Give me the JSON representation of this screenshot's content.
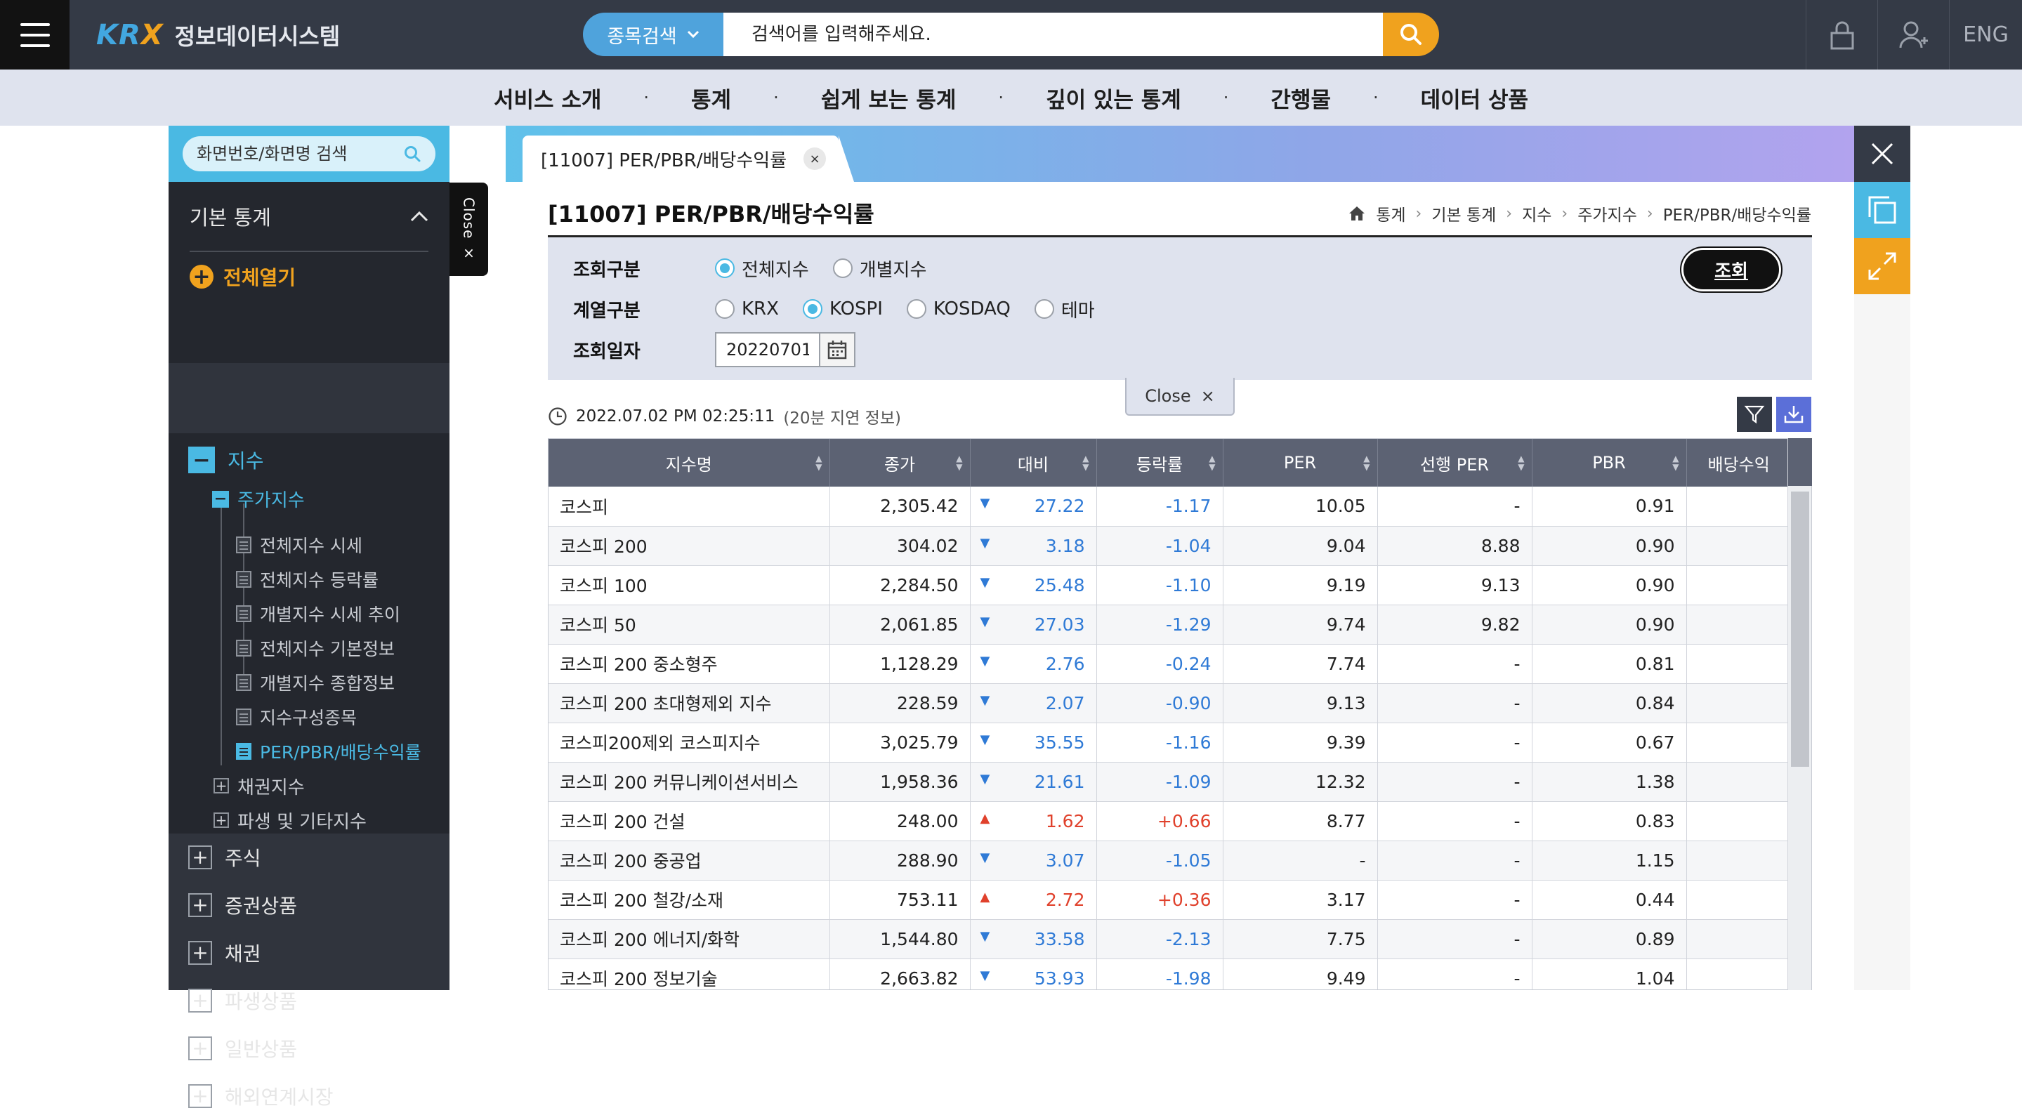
{
  "header": {
    "logo_brand": "KRX",
    "logo_title": "정보데이터시스템",
    "search_type": "종목검색",
    "search_placeholder": "검색어를 입력해주세요.",
    "lang": "ENG"
  },
  "gnb": [
    "서비스 소개",
    "통계",
    "쉽게 보는 통계",
    "깊이 있는 통계",
    "간행물",
    "데이터 상품"
  ],
  "sidebar": {
    "search_placeholder": "화면번호/화면명 검색",
    "section_title": "기본 통계",
    "expand_all": "전체열기",
    "root": "지수",
    "sub": "주가지수",
    "leaves": [
      "전체지수 시세",
      "전체지수 등락률",
      "개별지수 시세 추이",
      "전체지수 기본정보",
      "개별지수 종합정보",
      "지수구성종목",
      "PER/PBR/배당수익률"
    ],
    "siblings": [
      "채권지수",
      "파생 및 기타지수"
    ],
    "categories": [
      "주식",
      "증권상품",
      "채권",
      "파생상품",
      "일반상품",
      "해외연계시장"
    ],
    "close_label": "Close ×"
  },
  "tab": {
    "label": "[11007] PER/PBR/배당수익률",
    "close": "×"
  },
  "page": {
    "title": "[11007] PER/PBR/배당수익률",
    "breadcrumb": [
      "통계",
      "기본 통계",
      "지수",
      "주가지수",
      "PER/PBR/배당수익률"
    ]
  },
  "filters": {
    "row1_label": "조회구분",
    "row1_options": [
      "전체지수",
      "개별지수"
    ],
    "row1_selected": "전체지수",
    "row2_label": "계열구분",
    "row2_options": [
      "KRX",
      "KOSPI",
      "KOSDAQ",
      "테마"
    ],
    "row2_selected": "KOSPI",
    "row3_label": "조회일자",
    "date_value": "20220701",
    "query_button": "조회"
  },
  "close_popup": {
    "label": "Close",
    "x": "×"
  },
  "timestamp": {
    "time": "2022.07.02 PM 02:25:11",
    "delay": "(20분 지연 정보)"
  },
  "table": {
    "headers": [
      "지수명",
      "종가",
      "대비",
      "등락률",
      "PER",
      "선행 PER",
      "PBR",
      "배당수익"
    ],
    "rows": [
      {
        "name": "코스피",
        "close": "2,305.42",
        "dir": "down",
        "chg": "27.22",
        "rate": "-1.17",
        "per": "10.05",
        "fper": "-",
        "pbr": "0.91"
      },
      {
        "name": "코스피 200",
        "close": "304.02",
        "dir": "down",
        "chg": "3.18",
        "rate": "-1.04",
        "per": "9.04",
        "fper": "8.88",
        "pbr": "0.90"
      },
      {
        "name": "코스피 100",
        "close": "2,284.50",
        "dir": "down",
        "chg": "25.48",
        "rate": "-1.10",
        "per": "9.19",
        "fper": "9.13",
        "pbr": "0.90"
      },
      {
        "name": "코스피 50",
        "close": "2,061.85",
        "dir": "down",
        "chg": "27.03",
        "rate": "-1.29",
        "per": "9.74",
        "fper": "9.82",
        "pbr": "0.90"
      },
      {
        "name": "코스피 200 중소형주",
        "close": "1,128.29",
        "dir": "down",
        "chg": "2.76",
        "rate": "-0.24",
        "per": "7.74",
        "fper": "-",
        "pbr": "0.81"
      },
      {
        "name": "코스피 200 초대형제외 지수",
        "close": "228.59",
        "dir": "down",
        "chg": "2.07",
        "rate": "-0.90",
        "per": "9.13",
        "fper": "-",
        "pbr": "0.84"
      },
      {
        "name": "코스피200제외 코스피지수",
        "close": "3,025.79",
        "dir": "down",
        "chg": "35.55",
        "rate": "-1.16",
        "per": "9.39",
        "fper": "-",
        "pbr": "0.67"
      },
      {
        "name": "코스피 200 커뮤니케이션서비스",
        "close": "1,958.36",
        "dir": "down",
        "chg": "21.61",
        "rate": "-1.09",
        "per": "12.32",
        "fper": "-",
        "pbr": "1.38"
      },
      {
        "name": "코스피 200 건설",
        "close": "248.00",
        "dir": "up",
        "chg": "1.62",
        "rate": "+0.66",
        "per": "8.77",
        "fper": "-",
        "pbr": "0.83"
      },
      {
        "name": "코스피 200 중공업",
        "close": "288.90",
        "dir": "down",
        "chg": "3.07",
        "rate": "-1.05",
        "per": "-",
        "fper": "-",
        "pbr": "1.15"
      },
      {
        "name": "코스피 200 철강/소재",
        "close": "753.11",
        "dir": "up",
        "chg": "2.72",
        "rate": "+0.36",
        "per": "3.17",
        "fper": "-",
        "pbr": "0.44"
      },
      {
        "name": "코스피 200 에너지/화학",
        "close": "1,544.80",
        "dir": "down",
        "chg": "33.58",
        "rate": "-2.13",
        "per": "7.75",
        "fper": "-",
        "pbr": "0.89"
      },
      {
        "name": "코스피 200 정보기술",
        "close": "2,663.82",
        "dir": "down",
        "chg": "53.93",
        "rate": "-1.98",
        "per": "9.49",
        "fper": "-",
        "pbr": "1.04"
      }
    ]
  },
  "colors": {
    "accent_blue": "#4ab9e3",
    "accent_orange": "#f0a21e",
    "down": "#2f7ad6",
    "up": "#e0412c",
    "header_dark": "#343a46"
  }
}
